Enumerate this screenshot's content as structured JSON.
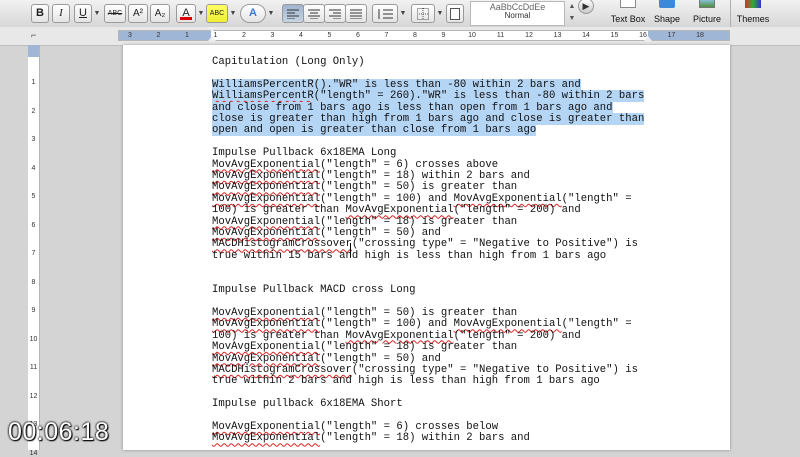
{
  "toolbar": {
    "bold": "B",
    "italic": "I",
    "underline": "U",
    "strikethrough": "ABC",
    "superscript": "A²",
    "subscript": "A₂",
    "font_color": "A",
    "highlight": "ABC",
    "text_effects": "A",
    "style_sample": "AaBbCcDdEe",
    "style_name": "Normal",
    "text_box_label": "Text Box",
    "shape_label": "Shape",
    "picture_label": "Picture",
    "themes_label": "Themes"
  },
  "ruler": {
    "ticks": [
      "3",
      "2",
      "1",
      "1",
      "2",
      "3",
      "4",
      "5",
      "6",
      "7",
      "8",
      "9",
      "10",
      "11",
      "12",
      "13",
      "14",
      "15",
      "16",
      "17",
      "18"
    ],
    "vertical_ticks": [
      "1",
      "2",
      "3",
      "4",
      "5",
      "6",
      "7",
      "8",
      "9",
      "10",
      "11",
      "12",
      "13",
      "14"
    ]
  },
  "document": {
    "heading1": "Capitulation (Long Only)",
    "sel_l1a": "WilliamsPercentR",
    "sel_l1b": "().\"WR\" is less than -80 within 2 bars and",
    "sel_l2a": "WilliamsPercentR",
    "sel_l2b": "(\"length\" = 260).\"WR\" is less than -80 within 2 bars",
    "sel_l3": "and close from 1 bars ago is less than open from 1 bars ago and",
    "sel_l4": "close is greater than high from 1 bars ago and close is greater than",
    "sel_l5": "open and open is greater than close from 1 bars ago",
    "heading2": "Impulse Pullback 6x18EMA Long",
    "mae": "MovAvgExponential",
    "mhc": "MACDHistogramCrossover",
    "s2_l1": "(\"length\" = 6) crosses above",
    "s2_l2": "(\"length\" = 18) within 2 bars and",
    "s2_l3": "(\"length\" = 50) is greater than",
    "s2_l4a": "(\"length\" = 100) and ",
    "s2_l4b": "(\"length\" =",
    "s2_l5a": "100) is greater than ",
    "s2_l5b": "(\"length\" = 200) and",
    "s2_l6": "(\"length\" = 18) is greater than",
    "s2_l7": "(\"length\" = 50) and",
    "s2_l8": "(\"crossing type\" = \"Negative to Positive\") is",
    "s2_l9": "true within 15 bars and high is less than high from 1 bars ago",
    "heading3": "Impulse Pullback MACD cross Long",
    "s3_l1": "(\"length\" = 50) is greater than",
    "s3_l2a": "(\"length\" = 100) and ",
    "s3_l2b": "(\"length\" =",
    "s3_l3a": "100) is greater than ",
    "s3_l3b": "(\"length\" = 200) and",
    "s3_l4": "(\"length\" = 18) is greater than",
    "s3_l5": "(\"length\" = 50) and",
    "s3_l6": "(\"crossing type\" = \"Negative to Positive\") is",
    "s3_l7": "true within 2 bars and high is less than high from 1 bars ago",
    "heading4": "Impulse pullback 6x18EMA Short",
    "s4_l1": "(\"length\" = 6) crosses below",
    "s4_l2": "(\"length\" = 18) within 2 bars and"
  },
  "video": {
    "timestamp": "00:06:18"
  },
  "colors": {
    "selection": "#b5d5f5",
    "spellcheck": "#dd2222",
    "ruler_margin": "#9fb6d6"
  }
}
